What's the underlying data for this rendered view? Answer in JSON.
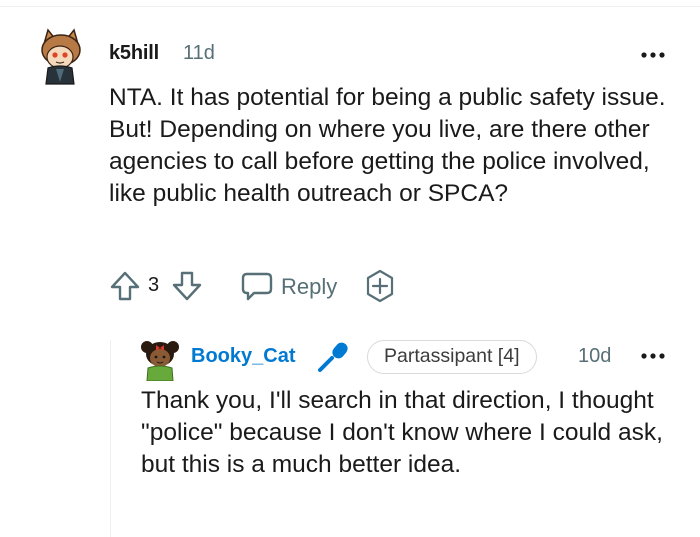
{
  "comment": {
    "author": "k5hill",
    "age": "11d",
    "avatar_icon": "cat-ears-avatar-icon",
    "body": "NTA. It has potential for being a public safety issue. But! Depending on where you live, are there other agencies to call before getting the police involved, like public health outreach or SPCA?",
    "score": "3",
    "reply_label": "Reply",
    "more_icon": "more-options-icon",
    "award_icon": "award-plus-icon"
  },
  "reply": {
    "author": "Booky_Cat",
    "age": "10d",
    "flair": "Partassipant [4]",
    "avatar_icon": "pigtails-avatar-icon",
    "badge_icon": "microphone-icon",
    "body": "Thank you, I'll search in that direction, I thought \"police\" because I don't know where I could ask, but this is a much better idea."
  },
  "colors": {
    "text": "#1a1a1b",
    "muted": "#576f76",
    "username_accent": "#0079d3",
    "icon_stroke": "#576f76",
    "divider": "#edeff1"
  }
}
